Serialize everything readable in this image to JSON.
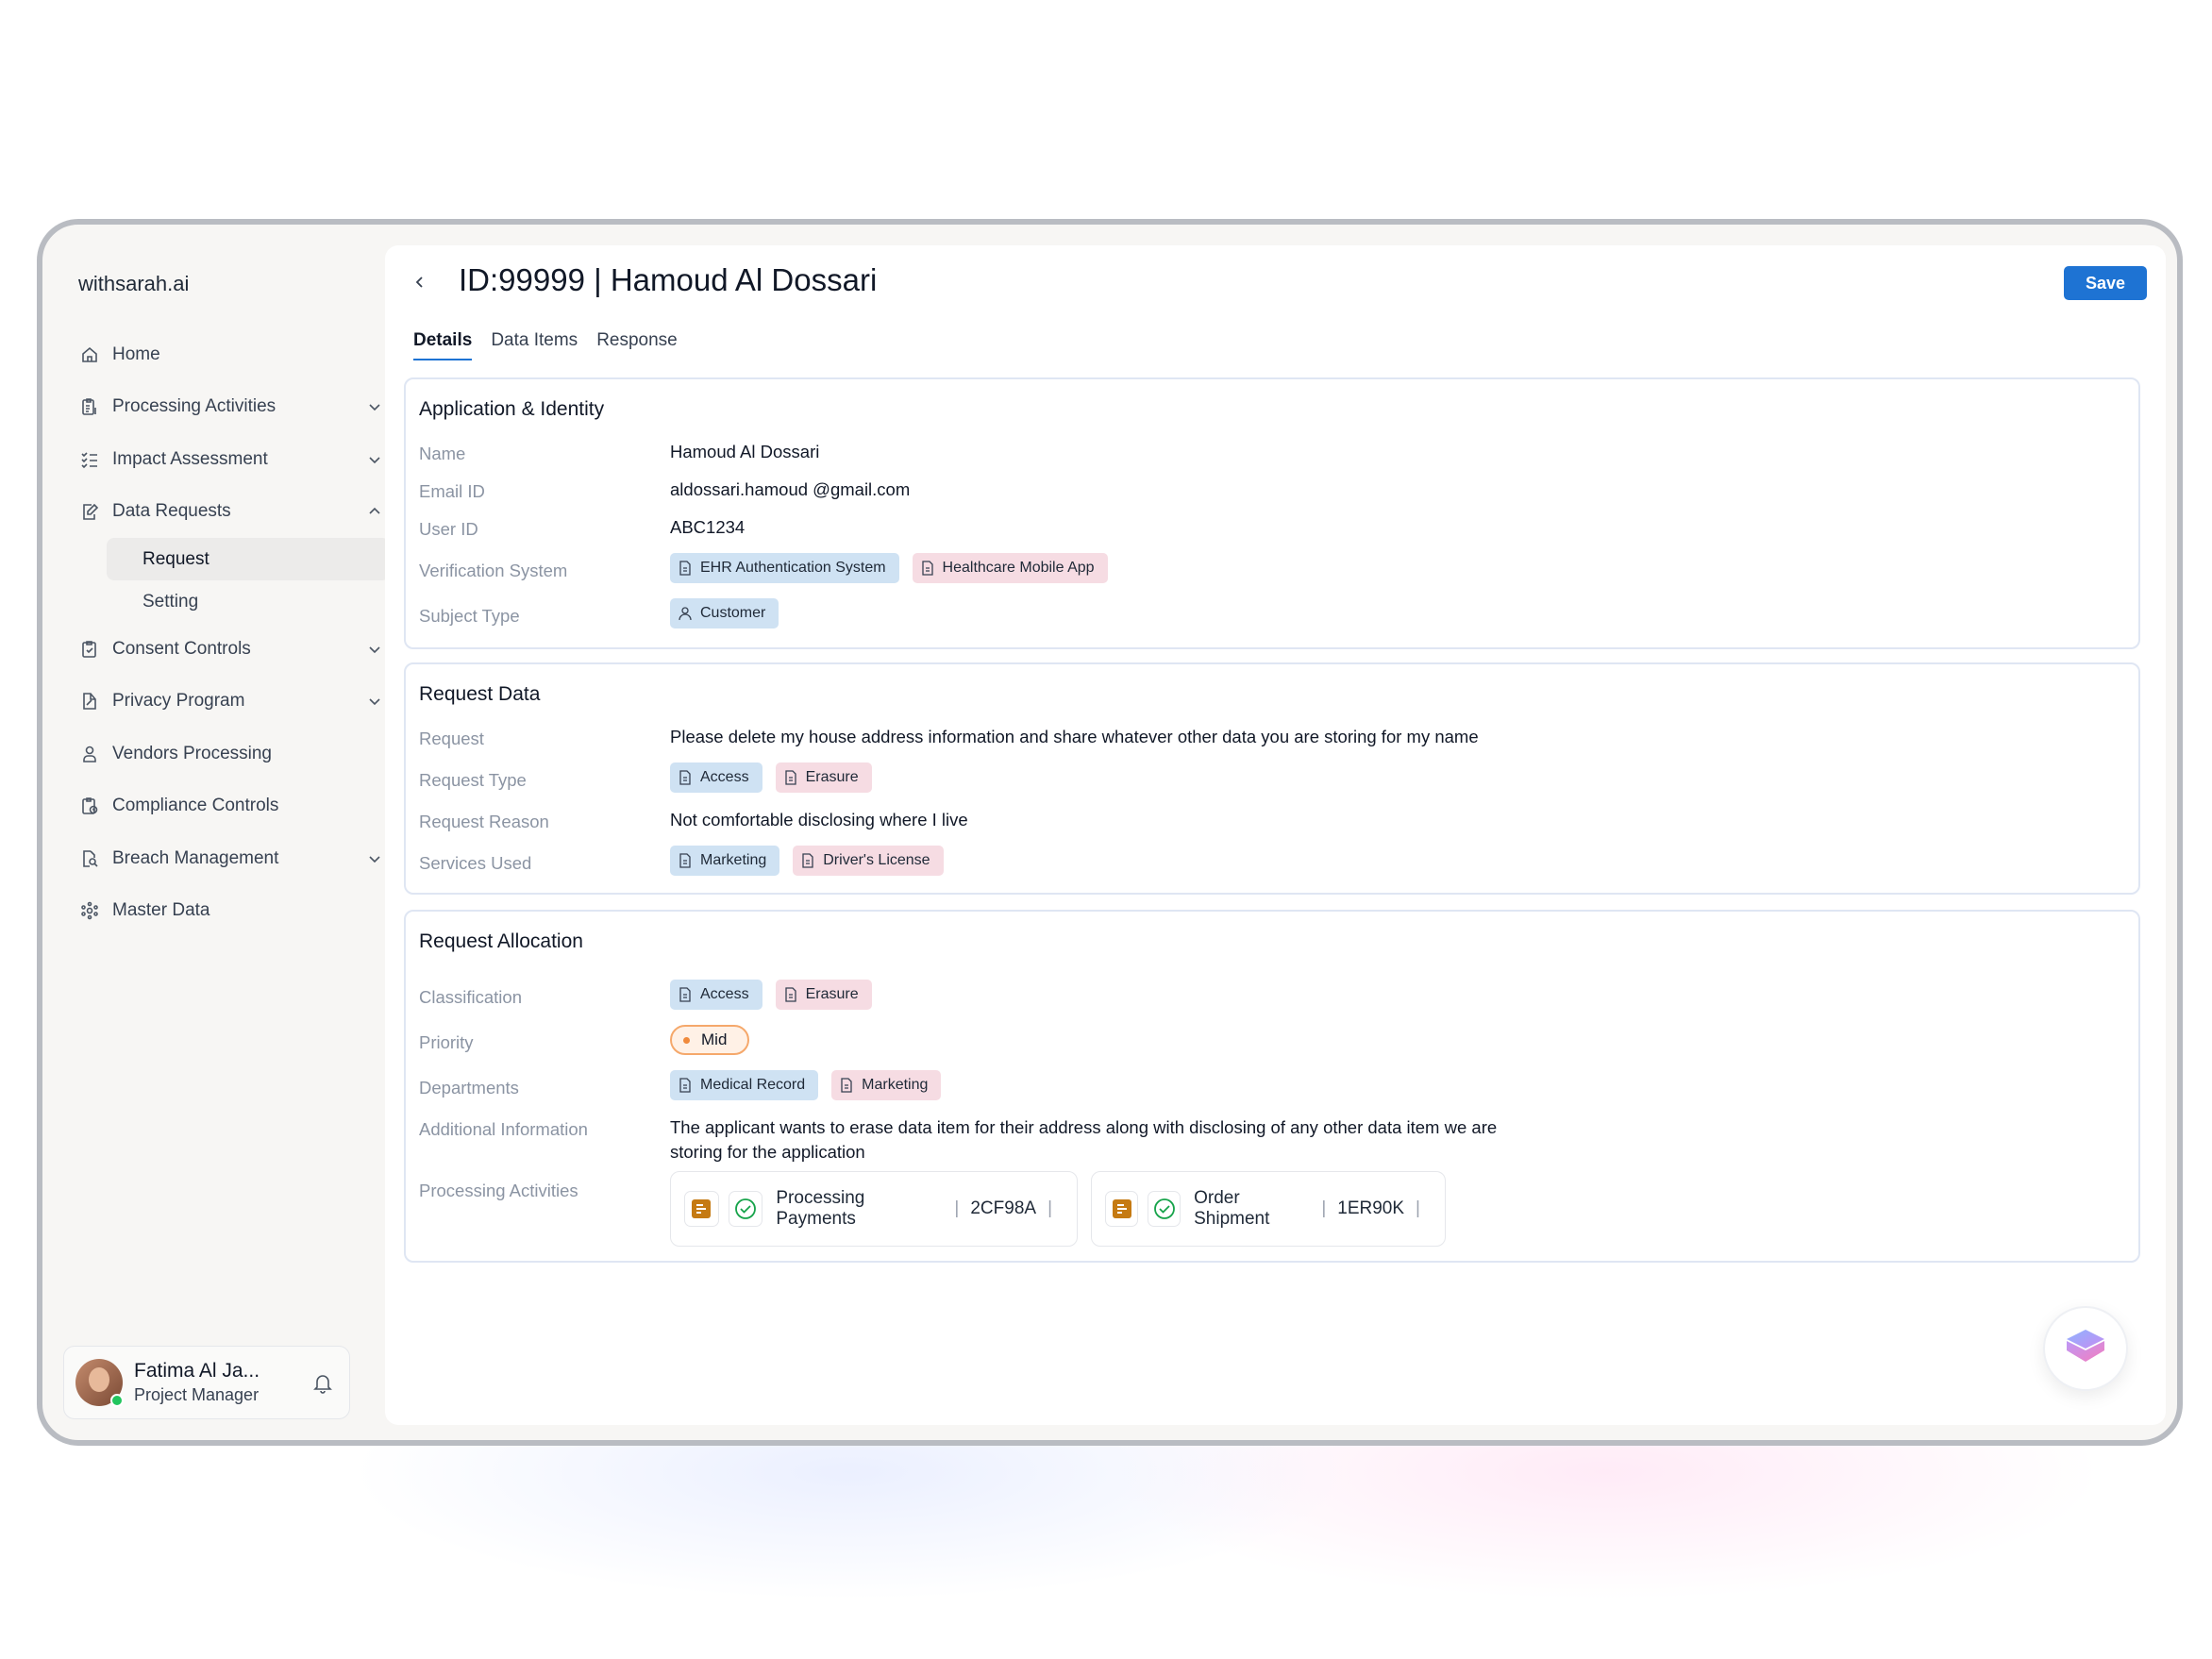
{
  "app": {
    "brand": "withsarah.ai"
  },
  "sidebar": {
    "items": [
      {
        "label": "Home",
        "icon": "home-icon",
        "chevron": "none"
      },
      {
        "label": "Processing Activities",
        "icon": "clipboard-list-icon",
        "chevron": "down"
      },
      {
        "label": "Impact Assessment",
        "icon": "checklist-icon",
        "chevron": "down"
      },
      {
        "label": "Data Requests",
        "icon": "edit-document-icon",
        "chevron": "up"
      },
      {
        "label": "Consent Controls",
        "icon": "clipboard-check-icon",
        "chevron": "down"
      },
      {
        "label": "Privacy Program",
        "icon": "document-edit-icon",
        "chevron": "down"
      },
      {
        "label": "Vendors Processing",
        "icon": "user-icon",
        "chevron": "none"
      },
      {
        "label": "Compliance Controls",
        "icon": "clipboard-clock-icon",
        "chevron": "none"
      },
      {
        "label": "Breach Management",
        "icon": "document-search-icon",
        "chevron": "down"
      },
      {
        "label": "Master Data",
        "icon": "hub-icon",
        "chevron": "none"
      }
    ],
    "sub_items": [
      {
        "label": "Request",
        "active": true
      },
      {
        "label": "Setting",
        "active": false
      }
    ],
    "user": {
      "name": "Fatima Al Ja...",
      "role": "Project Manager"
    }
  },
  "header": {
    "title": "ID:99999 | Hamoud Al Dossari",
    "save_label": "Save"
  },
  "tabs": [
    {
      "label": "Details",
      "active": true
    },
    {
      "label": "Data Items",
      "active": false
    },
    {
      "label": "Response",
      "active": false
    }
  ],
  "identity": {
    "title": "Application & Identity",
    "name_label": "Name",
    "name": "Hamoud Al Dossari",
    "email_label": "Email ID",
    "email": "aldossari.hamoud @gmail.com",
    "userid_label": "User ID",
    "userid": "ABC1234",
    "verification_label": "Verification System",
    "verification": [
      "EHR Authentication System",
      "Healthcare Mobile App"
    ],
    "subject_label": "Subject Type",
    "subject": "Customer"
  },
  "request_data": {
    "title": "Request Data",
    "request_label": "Request",
    "request": "Please delete my house address information and share whatever other data you are storing for my name",
    "type_label": "Request Type",
    "types": [
      "Access",
      "Erasure"
    ],
    "reason_label": "Request Reason",
    "reason": "Not comfortable disclosing where I live",
    "services_label": "Services Used",
    "services": [
      "Marketing",
      "Driver's License"
    ]
  },
  "allocation": {
    "title": "Request Allocation",
    "classification_label": "Classification",
    "classification": [
      "Access",
      "Erasure"
    ],
    "priority_label": "Priority",
    "priority": "Mid",
    "departments_label": "Departments",
    "departments": [
      "Medical Record",
      "Marketing"
    ],
    "additional_label": "Additional Information",
    "additional_line1": "The applicant wants to erase data item for their address along with disclosing of any other data item we are",
    "additional_line2": "storing for the application",
    "activities_label": "Processing Activities",
    "activities": [
      {
        "name": "Processing Payments",
        "code": "2CF98A"
      },
      {
        "name": "Order Shipment",
        "code": "1ER90K"
      }
    ]
  },
  "colors": {
    "accent": "#1e73d3",
    "chip_blue": "#cfe2f3",
    "chip_pink": "#f6dce3",
    "priority": "#f08a3c"
  }
}
